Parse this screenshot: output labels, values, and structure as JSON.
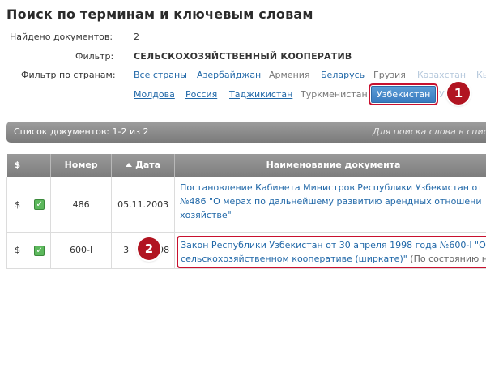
{
  "page": {
    "title": "Поиск по терминам и ключевым словам"
  },
  "meta": {
    "found_label": "Найдено документов:",
    "found_value": "2",
    "filter_label": "Фильтр:",
    "filter_value": "СЕЛЬСКОХОЗЯЙСТВЕННЫЙ КООПЕРАТИВ",
    "countries_label": "Фильтр по странам:"
  },
  "countries": {
    "all": "Все страны",
    "azerbaijan": "Азербайджан",
    "armenia": "Армения",
    "belarus": "Беларусь",
    "georgia": "Грузия",
    "kazakhstan": "Казахстан",
    "kyrgyzstan_partial": "Кы",
    "moldova": "Молдова",
    "russia": "Россия",
    "tajikistan": "Таджикистан",
    "turkmenistan": "Туркменистан",
    "uzbekistan": "Узбекистан",
    "ukraine_partial": "У"
  },
  "markers": {
    "one": "1",
    "two": "2"
  },
  "list_bar": {
    "count": "Список документов: 1-2 из 2",
    "hint": "Для поиска слова в списке"
  },
  "table": {
    "headers": {
      "dollar": "$",
      "number": "Номер",
      "date": "Дата",
      "name": "Наименование документа"
    },
    "rows": [
      {
        "dollar": "$",
        "number": "486",
        "date": "05.11.2003",
        "title_line1": "Постановление Кабинета Министров Республики Узбекистан от",
        "title_line2": "№486 \"О мерах по дальнейшему развитию арендных отношени",
        "title_line3": "хозяйстве\""
      },
      {
        "dollar": "$",
        "number": "600-I",
        "date_left": "3",
        "date_right": "998",
        "title_line1": "Закон Республики Узбекистан от 30 апреля 1998 года №600-I \"О",
        "title_line2": "сельскохозяйственном кооперативе (ширкате)\"",
        "title_note": "(По состоянию н"
      }
    ]
  }
}
